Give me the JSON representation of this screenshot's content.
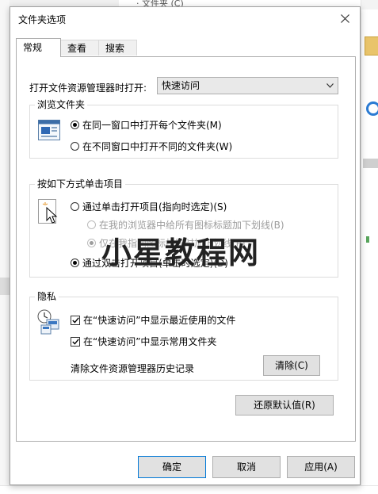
{
  "background": {
    "top_text": "· 文件夹 (C)"
  },
  "dialog": {
    "title": "文件夹选项",
    "close_icon": "close-icon"
  },
  "tabs": [
    {
      "label": "常规",
      "active": true
    },
    {
      "label": "查看",
      "active": false
    },
    {
      "label": "搜索",
      "active": false
    }
  ],
  "general": {
    "open_label": "打开文件资源管理器时打开:",
    "open_value": "快速访问",
    "browse_group": {
      "title": "浏览文件夹",
      "options": [
        {
          "label": "在同一窗口中打开每个文件夹(M)",
          "checked": true
        },
        {
          "label": "在不同窗口中打开不同的文件夹(W)",
          "checked": false
        }
      ]
    },
    "click_group": {
      "title": "按如下方式单击项目",
      "options": [
        {
          "label": "通过单击打开项目(指向时选定)(S)",
          "checked": false,
          "disabled": false
        },
        {
          "label": "在我的浏览器中给所有图标标题加下划线(B)",
          "checked": false,
          "disabled": true
        },
        {
          "label": "仅在我指向图标标题时加下划线(P)",
          "checked": true,
          "disabled": true
        },
        {
          "label": "通过双击打开项目(单击时选定)(D)",
          "checked": true,
          "disabled": false
        }
      ]
    },
    "privacy_group": {
      "title": "隐私",
      "checks": [
        {
          "label": "在“快速访问”中显示最近使用的文件",
          "checked": true
        },
        {
          "label": "在“快速访问”中显示常用文件夹",
          "checked": true
        }
      ],
      "clear_label": "清除文件资源管理器历史记录",
      "clear_button": "清除(C)"
    },
    "restore_button": "还原默认值(R)"
  },
  "footer": {
    "ok": "确定",
    "cancel": "取消",
    "apply": "应用(A)"
  },
  "watermark": "小星教程网"
}
